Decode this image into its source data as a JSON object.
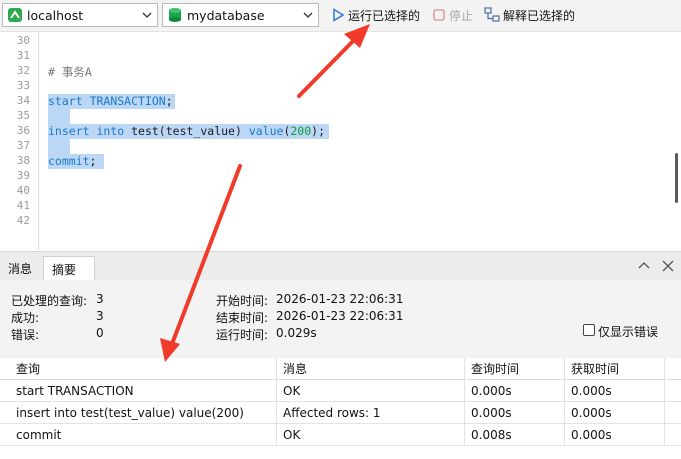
{
  "toolbar": {
    "connection": "localhost",
    "database": "mydatabase",
    "run_selected": "运行已选择的",
    "stop": "停止",
    "explain_selected": "解释已选择的"
  },
  "editor": {
    "line_numbers": [
      "30",
      "31",
      "32",
      "33",
      "34",
      "35",
      "36",
      "37",
      "38",
      "39",
      "40",
      "41",
      "42"
    ],
    "comment": "# 事务A",
    "line34": {
      "kw1": "start",
      "kw2": "TRANSACTION",
      "end": ";"
    },
    "line36": {
      "kw1": "insert",
      "kw2": "into",
      "mid": " test(test_value) ",
      "kw3": "value",
      "open": "(",
      "num": "200",
      "close": ");"
    },
    "line38": {
      "kw1": "commit",
      "end": ";"
    }
  },
  "panel": {
    "tabs": [
      "消息",
      "摘要"
    ],
    "active_tab": "摘要"
  },
  "summary": {
    "processed_label": "已处理的查询:",
    "processed_value": "3",
    "success_label": "成功:",
    "success_value": "3",
    "error_label": "错误:",
    "error_value": "0",
    "start_label": "开始时间:",
    "start_value": "2026-01-23 22:06:31",
    "end_label": "结束时间:",
    "end_value": "2026-01-23 22:06:31",
    "runtime_label": "运行时间:",
    "runtime_value": "0.029s",
    "only_errors_label": "仅显示错误"
  },
  "results": {
    "headers": [
      "查询",
      "消息",
      "查询时间",
      "获取时间"
    ],
    "rows": [
      [
        "start TRANSACTION",
        "OK",
        "0.000s",
        "0.000s"
      ],
      [
        "insert into test(test_value) value(200)",
        "Affected rows: 1",
        "0.000s",
        "0.000s"
      ],
      [
        "commit",
        "OK",
        "0.008s",
        "0.000s"
      ]
    ]
  },
  "colors": {
    "keyword": "#1a78c8",
    "number": "#0a9a3a",
    "selection": "#bcd7f5",
    "arrow": "#f03a2a",
    "run_icon": "#2f7bd6",
    "db_icon": "#1aa34a"
  },
  "icons": [
    "connection-icon",
    "database-icon",
    "run-icon",
    "stop-icon",
    "explain-icon",
    "chevron-down-icon",
    "chevron-up-icon",
    "close-icon"
  ]
}
